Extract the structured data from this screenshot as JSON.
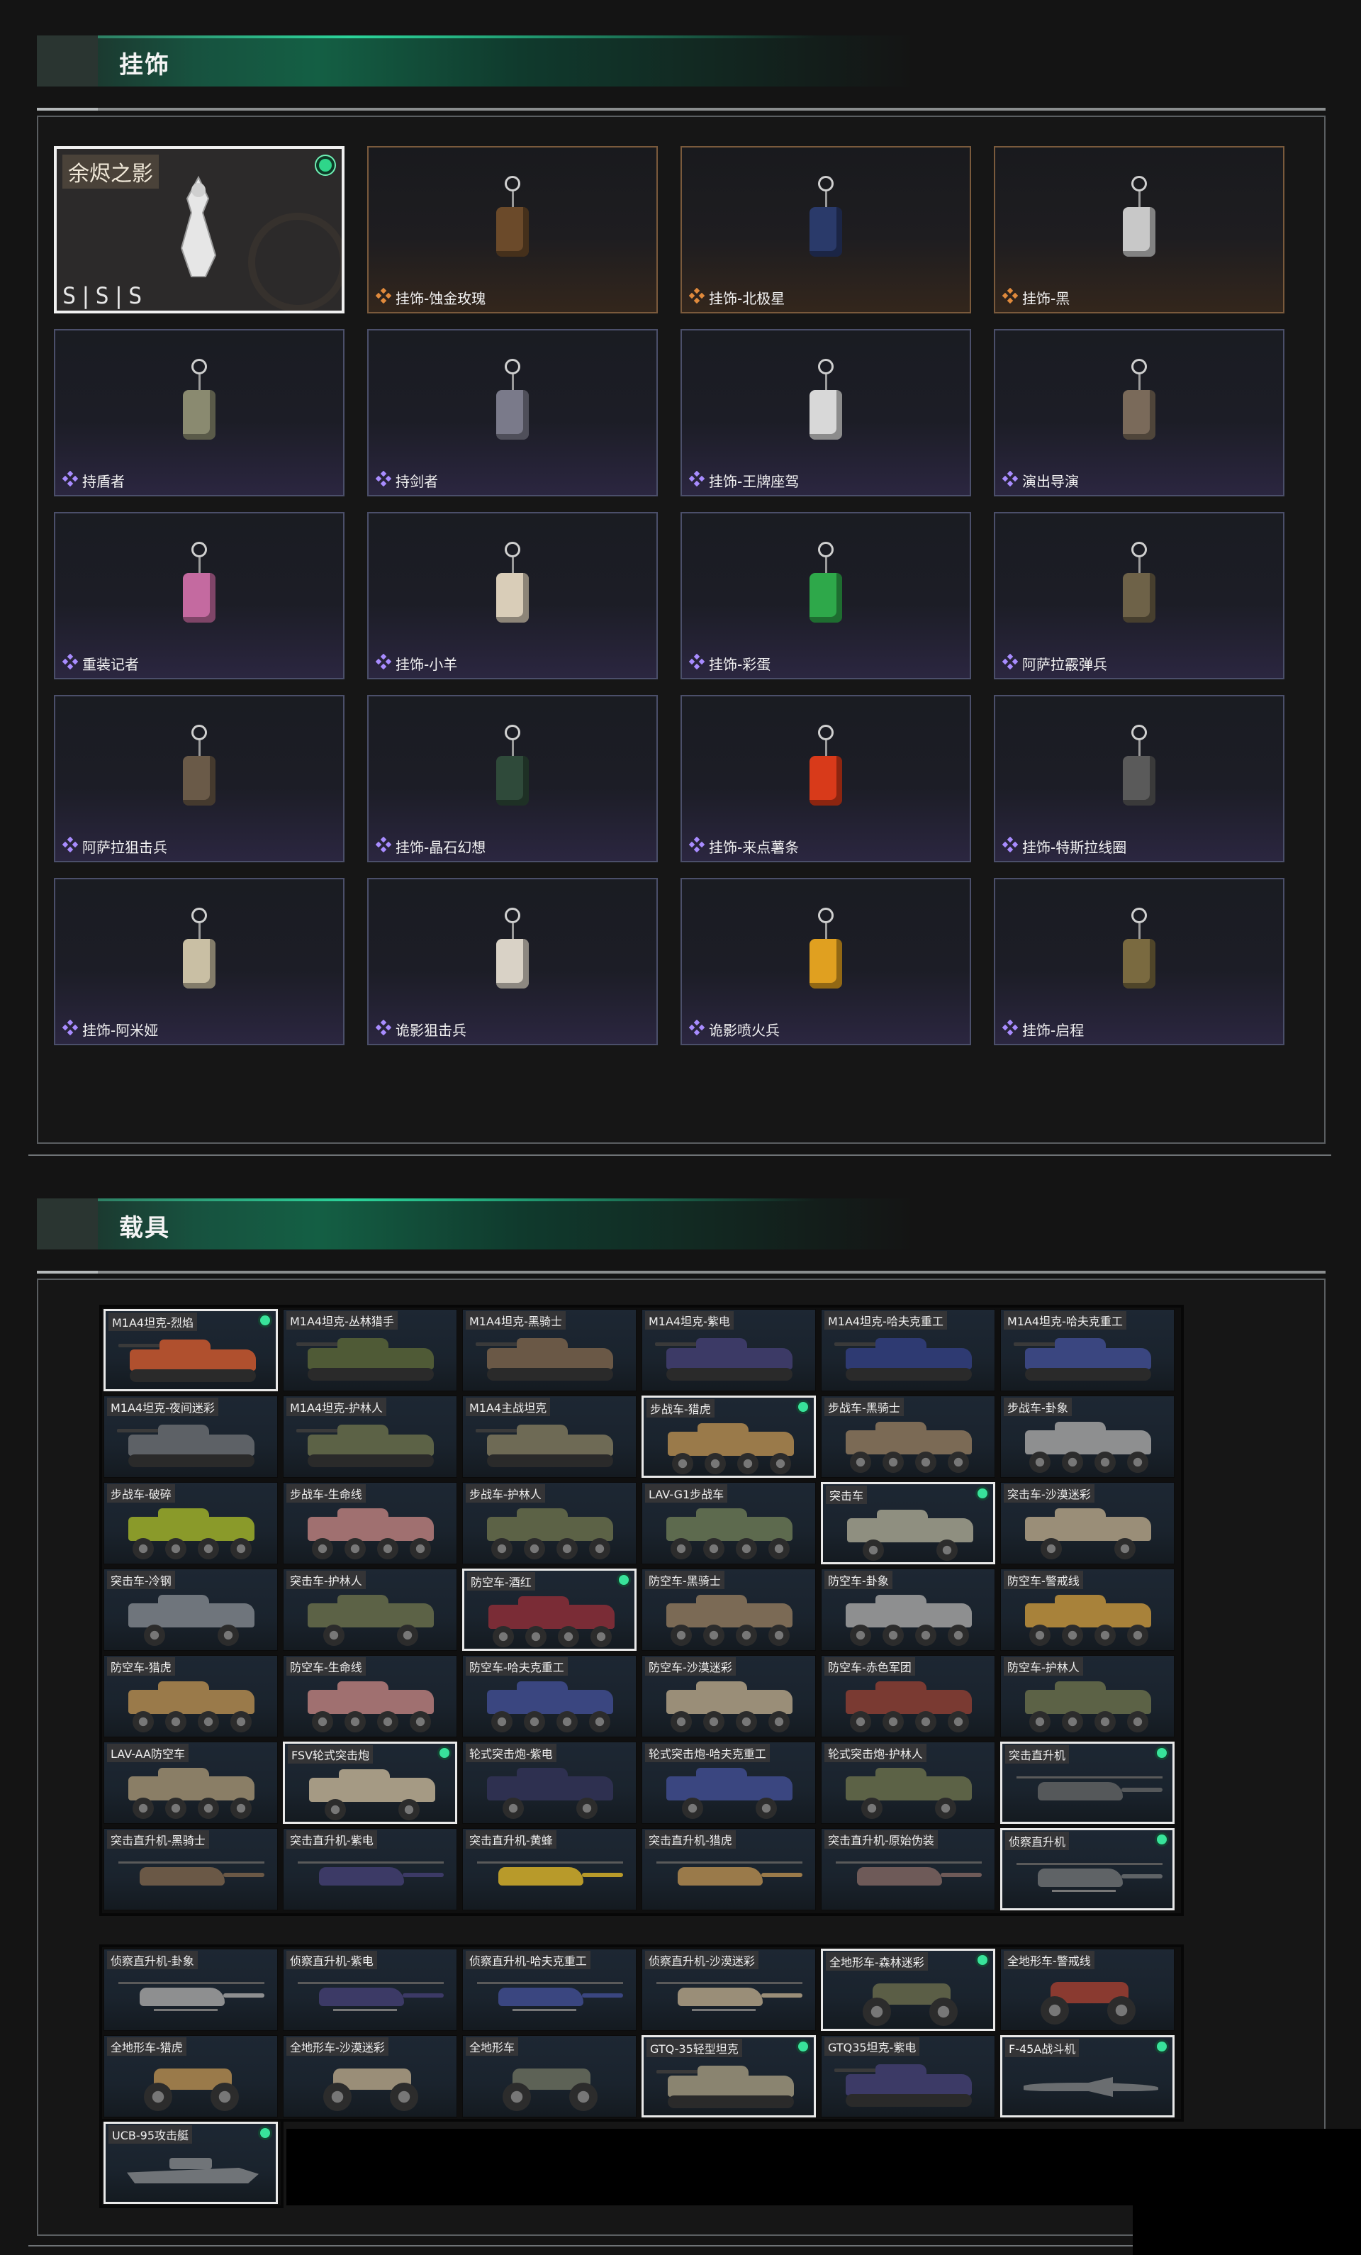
{
  "sections": {
    "pendants_title": "挂饰",
    "vehicles_title": "载具"
  },
  "colors": {
    "accent_green": "#2fd68a",
    "purple_rarity": "#a88cff",
    "orange_rarity": "#e08a3c"
  },
  "pendants": {
    "featured": {
      "title": "余烬之影",
      "tag": "S|S|S",
      "equipped": true,
      "icon": "ember-shadow-figure"
    },
    "items": [
      {
        "label": "挂饰-蚀金玫瑰",
        "rarity": "orange",
        "icon": "golden-rose-pendant"
      },
      {
        "label": "挂饰-北极星",
        "rarity": "orange",
        "icon": "north-star-pendant"
      },
      {
        "label": "挂饰-黑",
        "rarity": "orange",
        "icon": "black-tag-pendant"
      },
      {
        "label": "持盾者",
        "rarity": "purple",
        "icon": "shield-bearer-figure"
      },
      {
        "label": "持剑者",
        "rarity": "purple",
        "icon": "swordsman-figure"
      },
      {
        "label": "挂饰-王牌座驾",
        "rarity": "purple",
        "icon": "jet-pendant"
      },
      {
        "label": "演出导演",
        "rarity": "purple",
        "icon": "director-figure"
      },
      {
        "label": "重装记者",
        "rarity": "purple",
        "icon": "heavy-reporter-figure"
      },
      {
        "label": "挂饰-小羊",
        "rarity": "purple",
        "icon": "lamb-pendant"
      },
      {
        "label": "挂饰-彩蛋",
        "rarity": "purple",
        "icon": "easter-egg-pendant"
      },
      {
        "label": "阿萨拉霰弹兵",
        "rarity": "purple",
        "icon": "shotgunner-figure"
      },
      {
        "label": "阿萨拉狙击兵",
        "rarity": "purple",
        "icon": "sniper-figure"
      },
      {
        "label": "挂饰-晶石幻想",
        "rarity": "purple",
        "icon": "crystal-cube-pendant"
      },
      {
        "label": "挂饰-来点薯条",
        "rarity": "purple",
        "icon": "fries-pendant"
      },
      {
        "label": "挂饰-特斯拉线圈",
        "rarity": "purple",
        "icon": "tesla-coil-pendant"
      },
      {
        "label": "挂饰-阿米娅",
        "rarity": "purple",
        "icon": "amiya-pendant"
      },
      {
        "label": "诡影狙击兵",
        "rarity": "purple",
        "icon": "ghost-sniper-figure"
      },
      {
        "label": "诡影喷火兵",
        "rarity": "purple",
        "icon": "ghost-flamer-figure"
      },
      {
        "label": "挂饰-启程",
        "rarity": "purple",
        "icon": "journey-medallion-pendant"
      }
    ]
  },
  "vehicles_main": [
    {
      "label": "M1A4坦克-烈焰",
      "type": "tank",
      "sel": true,
      "owned": true,
      "c": "#b0502e"
    },
    {
      "label": "M1A4坦克-丛林猎手",
      "type": "tank",
      "sel": false,
      "owned": false,
      "c": "#4f5a36"
    },
    {
      "label": "M1A4坦克-黑骑士",
      "type": "tank",
      "sel": false,
      "owned": false,
      "c": "#6a5846"
    },
    {
      "label": "M1A4坦克-紫电",
      "type": "tank",
      "sel": false,
      "owned": false,
      "c": "#3c3a66"
    },
    {
      "label": "M1A4坦克-哈夫克重工",
      "type": "tank",
      "sel": false,
      "owned": false,
      "c": "#2e3a72"
    },
    {
      "label": "M1A4坦克-哈夫克重工",
      "type": "tank",
      "sel": false,
      "owned": false,
      "c": "#3a4680"
    },
    {
      "label": "M1A4坦克-夜间迷彩",
      "type": "tank",
      "sel": false,
      "owned": false,
      "c": "#5d6166"
    },
    {
      "label": "M1A4坦克-护林人",
      "type": "tank",
      "sel": false,
      "owned": false,
      "c": "#5c6246"
    },
    {
      "label": "M1A4主战坦克",
      "type": "tank",
      "sel": false,
      "owned": false,
      "c": "#6e6a55"
    },
    {
      "label": "步战车-猎虎",
      "type": "ifv",
      "sel": true,
      "owned": true,
      "c": "#9a7a4a"
    },
    {
      "label": "步战车-黑骑士",
      "type": "ifv",
      "sel": false,
      "owned": false,
      "c": "#7b6a55"
    },
    {
      "label": "步战车-卦象",
      "type": "ifv",
      "sel": false,
      "owned": false,
      "c": "#8e8f90"
    },
    {
      "label": "步战车-破碎",
      "type": "ifv",
      "sel": false,
      "owned": false,
      "c": "#8a9a2a"
    },
    {
      "label": "步战车-生命线",
      "type": "ifv",
      "sel": false,
      "owned": false,
      "c": "#a07070"
    },
    {
      "label": "步战车-护林人",
      "type": "ifv",
      "sel": false,
      "owned": false,
      "c": "#5c6246"
    },
    {
      "label": "LAV-G1步战车",
      "type": "ifv",
      "sel": false,
      "owned": false,
      "c": "#5d6a4e"
    },
    {
      "label": "突击车",
      "type": "car",
      "sel": true,
      "owned": true,
      "c": "#8f8f80"
    },
    {
      "label": "突击车-沙漠迷彩",
      "type": "car",
      "sel": false,
      "owned": false,
      "c": "#9a8e78"
    },
    {
      "label": "突击车-冷钢",
      "type": "car",
      "sel": false,
      "owned": false,
      "c": "#6f757c"
    },
    {
      "label": "突击车-护林人",
      "type": "car",
      "sel": false,
      "owned": false,
      "c": "#5c6246"
    },
    {
      "label": "防空车-酒红",
      "type": "ifv",
      "sel": true,
      "owned": true,
      "c": "#7a2c36"
    },
    {
      "label": "防空车-黑骑士",
      "type": "ifv",
      "sel": false,
      "owned": false,
      "c": "#7b6a55"
    },
    {
      "label": "防空车-卦象",
      "type": "ifv",
      "sel": false,
      "owned": false,
      "c": "#8e8f90"
    },
    {
      "label": "防空车-警戒线",
      "type": "ifv",
      "sel": false,
      "owned": false,
      "c": "#a8823a"
    },
    {
      "label": "防空车-猎虎",
      "type": "ifv",
      "sel": false,
      "owned": false,
      "c": "#9a7a4a"
    },
    {
      "label": "防空车-生命线",
      "type": "ifv",
      "sel": false,
      "owned": false,
      "c": "#a07070"
    },
    {
      "label": "防空车-哈夫克重工",
      "type": "ifv",
      "sel": false,
      "owned": false,
      "c": "#3a4680"
    },
    {
      "label": "防空车-沙漠迷彩",
      "type": "ifv",
      "sel": false,
      "owned": false,
      "c": "#9a8e78"
    },
    {
      "label": "防空车-赤色军团",
      "type": "ifv",
      "sel": false,
      "owned": false,
      "c": "#7a3a32"
    },
    {
      "label": "防空车-护林人",
      "type": "ifv",
      "sel": false,
      "owned": false,
      "c": "#5c6246"
    },
    {
      "label": "LAV-AA防空车",
      "type": "ifv",
      "sel": false,
      "owned": false,
      "c": "#8a7e66"
    },
    {
      "label": "FSV轮式突击炮",
      "type": "car",
      "sel": true,
      "owned": true,
      "c": "#a59a84"
    },
    {
      "label": "轮式突击炮-紫电",
      "type": "car",
      "sel": false,
      "owned": false,
      "c": "#2e3050"
    },
    {
      "label": "轮式突击炮-哈夫克重工",
      "type": "car",
      "sel": false,
      "owned": false,
      "c": "#3a4680"
    },
    {
      "label": "轮式突击炮-护林人",
      "type": "car",
      "sel": false,
      "owned": false,
      "c": "#5c6246"
    },
    {
      "label": "突击直升机",
      "type": "heli",
      "sel": true,
      "owned": true,
      "c": "#55585a"
    },
    {
      "label": "突击直升机-黑骑士",
      "type": "heli",
      "sel": false,
      "owned": false,
      "c": "#6a5846"
    },
    {
      "label": "突击直升机-紫电",
      "type": "heli",
      "sel": false,
      "owned": false,
      "c": "#3c3a66"
    },
    {
      "label": "突击直升机-黄蜂",
      "type": "heli",
      "sel": false,
      "owned": false,
      "c": "#b89a2a"
    },
    {
      "label": "突击直升机-猎虎",
      "type": "heli",
      "sel": false,
      "owned": false,
      "c": "#9a7a4a"
    },
    {
      "label": "突击直升机-原始伪装",
      "type": "heli",
      "sel": false,
      "owned": false,
      "c": "#6e5a58"
    },
    {
      "label": "侦察直升机",
      "type": "scout",
      "sel": true,
      "owned": true,
      "c": "#5f6366"
    }
  ],
  "vehicles_extra": [
    {
      "label": "侦察直升机-卦象",
      "type": "scout",
      "sel": false,
      "owned": false,
      "c": "#8e8f90"
    },
    {
      "label": "侦察直升机-紫电",
      "type": "scout",
      "sel": false,
      "owned": false,
      "c": "#3c3a66"
    },
    {
      "label": "侦察直升机-哈夫克重工",
      "type": "scout",
      "sel": false,
      "owned": false,
      "c": "#3a4680"
    },
    {
      "label": "侦察直升机-沙漠迷彩",
      "type": "scout",
      "sel": false,
      "owned": false,
      "c": "#9a8e78"
    },
    {
      "label": "全地形车-森林迷彩",
      "type": "atv",
      "sel": true,
      "owned": true,
      "c": "#5b5e46"
    },
    {
      "label": "全地形车-警戒线",
      "type": "atv",
      "sel": false,
      "owned": false,
      "c": "#8a3a30"
    },
    {
      "label": "全地形车-猎虎",
      "type": "atv",
      "sel": false,
      "owned": false,
      "c": "#9a7a4a"
    },
    {
      "label": "全地形车-沙漠迷彩",
      "type": "atv",
      "sel": false,
      "owned": false,
      "c": "#9a8e78"
    },
    {
      "label": "全地形车",
      "type": "atv",
      "sel": false,
      "owned": false,
      "c": "#5d6256"
    },
    {
      "label": "GTQ-35轻型坦克",
      "type": "tank",
      "sel": true,
      "owned": true,
      "c": "#8a8470"
    },
    {
      "label": "GTQ35坦克-紫电",
      "type": "tank",
      "sel": false,
      "owned": false,
      "c": "#3c3a66"
    },
    {
      "label": "F-45A战斗机",
      "type": "jet",
      "sel": true,
      "owned": true,
      "c": "#6a6d70"
    },
    {
      "label": "UCB-95攻击艇",
      "type": "boat",
      "sel": true,
      "owned": true,
      "c": "#707478"
    }
  ]
}
